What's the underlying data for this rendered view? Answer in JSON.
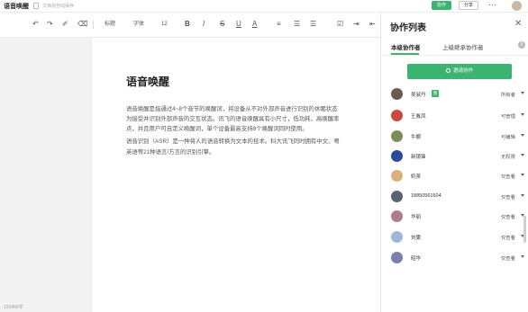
{
  "header": {
    "doc_title": "语音唤醒",
    "save_status": "文档将自动保存",
    "collab_button": "协作",
    "share_button": "分享",
    "more": "···"
  },
  "toolbar": {
    "undo": "↶",
    "redo": "↷",
    "format_painter": "✐",
    "clear_format": "⌫",
    "heading": "标题",
    "font": "字体",
    "font_size": "12",
    "bold": "B",
    "italic": "I",
    "strike": "S",
    "underline": "U",
    "font_color": "A",
    "align": "≡",
    "ordered_list": "☰",
    "bullet_list": "☰",
    "checklist": "☑",
    "indent": "⇥",
    "outdent": "⇤",
    "link": "↻"
  },
  "document": {
    "heading": "语音唤醒",
    "paragraphs": [
      "语音唤醒是指通过4~8个音节的唤醒词，将设备从不对外部声音进行识别的休眠状态",
      "为接受并识别外部声音的交互状态。讯飞的语音唤醒具有小尺寸，低功耗，高唤醒率",
      "点，并且用户可自定义唤醒词，单个设备最高支持8个唤醒词同时使用。",
      "语音识别（ASR）是一种将人的语音转换为文本的技术。科大讯飞同时拥有中文、粤",
      "英语等21种语言/方言的识别引擎。"
    ],
    "word_count": "123456字"
  },
  "panel": {
    "title": "协作列表",
    "close": "✕",
    "tabs": [
      "本级协作者",
      "上级继承协作者"
    ],
    "info": "i",
    "invite_label": "邀请协作",
    "collaborators": [
      {
        "name": "吴淑丹",
        "badge": "我",
        "permission": "所有者",
        "color": "#6b5a4e"
      },
      {
        "name": "王胤凤",
        "badge": "",
        "permission": "可管理",
        "color": "#c84a3c"
      },
      {
        "name": "牛郦",
        "badge": "",
        "permission": "可编辑",
        "color": "#7b8e5a"
      },
      {
        "name": "新镜锋",
        "badge": "",
        "permission": "无权限",
        "color": "#2a4a9a"
      },
      {
        "name": "奶茶",
        "badge": "",
        "permission": "仅查看",
        "color": "#d9b27a"
      },
      {
        "name": "18850561604",
        "badge": "",
        "permission": "仅查看",
        "color": "#5a6470"
      },
      {
        "name": "华丽",
        "badge": "",
        "permission": "仅查看",
        "color": "#b07d8e"
      },
      {
        "name": "刘雯",
        "badge": "",
        "permission": "仅查看",
        "color": "#9fb8d8"
      },
      {
        "name": "昭华",
        "badge": "",
        "permission": "仅查看",
        "color": "#7a7fae"
      }
    ]
  }
}
